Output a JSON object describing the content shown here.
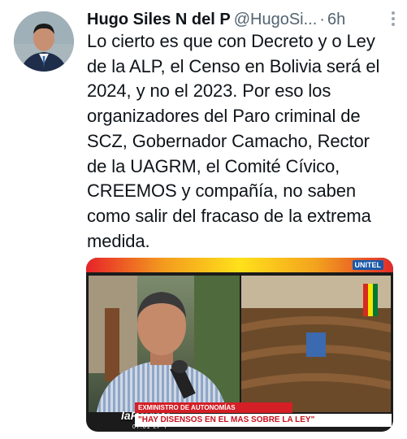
{
  "tweet": {
    "author_name": "Hugo Siles N del P",
    "handle": "@HugoSi...",
    "separator": "·",
    "time": "6h",
    "text_lines": [
      "Lo cierto es que con Decreto y o Ley",
      "de la ALP, el Censo en Bolivia será el",
      "2024, y no el 2023. Por eso los",
      "organizadores del Paro criminal de",
      "SCZ, Gobernador Camacho, Rector",
      "de la UAGRM, el Comité Cívico,",
      "CREEMOS y compañía, no saben",
      "como salir del fracaso de la extrema",
      "medida."
    ]
  },
  "media": {
    "channel_logo": "UNITEL",
    "show_name": "laRevista",
    "caption_small": "EXMINISTRO DE AUTONOMÍAS",
    "caption_big": "\"HAY DISENSOS EN EL MAS SOBRE LA LEY\"",
    "ticker": "07:01  LP  7°"
  },
  "colors": {
    "name": "#0f1419",
    "secondary": "#536471",
    "caption_red": "#d41f26"
  },
  "icons": {
    "more": "more-vertical-icon"
  }
}
